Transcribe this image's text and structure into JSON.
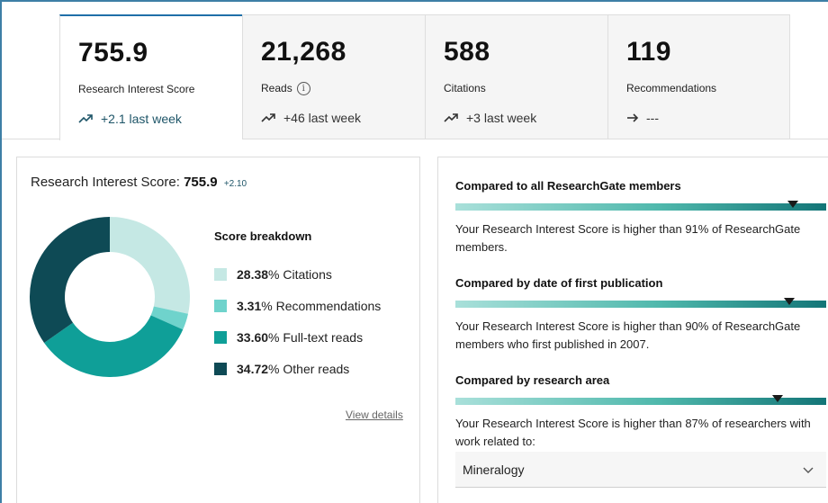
{
  "tabs": [
    {
      "value": "755.9",
      "label": "Research Interest Score",
      "trend": "+2.1 last week",
      "trend_icon": "trend-up-icon",
      "active": true
    },
    {
      "value": "21,268",
      "label": "Reads",
      "info_icon": "info-icon",
      "trend": "+46 last week",
      "trend_icon": "trend-up-icon"
    },
    {
      "value": "588",
      "label": "Citations",
      "trend": "+3 last week",
      "trend_icon": "trend-up-icon"
    },
    {
      "value": "119",
      "label": "Recommendations",
      "trend": "---",
      "trend_icon": "arrow-right-icon"
    }
  ],
  "score_card": {
    "title_prefix": "Research Interest Score:",
    "score": "755.9",
    "delta": "+2.10",
    "breakdown_title": "Score breakdown",
    "view_details": "View details",
    "breakdown": [
      {
        "pct": "28.38",
        "label": "% Citations",
        "value": 28.38,
        "color": "#c5e8e4"
      },
      {
        "pct": "3.31",
        "label": "% Recommendations",
        "value": 3.31,
        "color": "#6fd3cc"
      },
      {
        "pct": "33.60",
        "label": "% Full-text reads",
        "value": 33.6,
        "color": "#0f9f98"
      },
      {
        "pct": "34.72",
        "label": "% Other reads",
        "value": 34.72,
        "color": "#0e4a55"
      }
    ]
  },
  "comparisons": [
    {
      "title": "Compared to all ResearchGate members",
      "percentile": 91,
      "text": "Your Research Interest Score is higher than 91% of ResearchGate members."
    },
    {
      "title": "Compared by date of first publication",
      "percentile": 90,
      "text": "Your Research Interest Score is higher than 90% of ResearchGate members who first published in 2007."
    },
    {
      "title": "Compared by research area",
      "percentile": 87,
      "text": "Your Research Interest Score is higher than 87% of researchers with work related to:"
    }
  ],
  "research_area": {
    "selected": "Mineralogy",
    "icon": "chevron-down-icon"
  }
}
